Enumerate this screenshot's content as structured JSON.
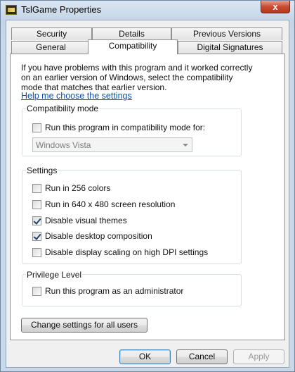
{
  "window": {
    "title": "TslGame Properties",
    "close_label": "x"
  },
  "tabs": {
    "row1": [
      "Security",
      "Details",
      "Previous Versions"
    ],
    "row2": [
      "General",
      "Compatibility",
      "Digital Signatures"
    ]
  },
  "intro": {
    "text": "If you have problems with this program and it worked correctly on an earlier version of Windows, select the compatibility mode that matches that earlier version.",
    "help_link": "Help me choose the settings"
  },
  "compat_mode": {
    "label": "Compatibility mode",
    "checkbox_label": "Run this program in compatibility mode for:",
    "checked": false,
    "selected_os": "Windows Vista"
  },
  "settings": {
    "label": "Settings",
    "items": [
      {
        "label": "Run in 256 colors",
        "checked": false
      },
      {
        "label": "Run in 640 x 480 screen resolution",
        "checked": false
      },
      {
        "label": "Disable visual themes",
        "checked": true
      },
      {
        "label": "Disable desktop composition",
        "checked": true
      },
      {
        "label": "Disable display scaling on high DPI settings",
        "checked": false
      }
    ]
  },
  "privilege": {
    "label": "Privilege Level",
    "checkbox_label": "Run this program as an administrator",
    "checked": false
  },
  "buttons": {
    "all_users": "Change settings for all users",
    "ok": "OK",
    "cancel": "Cancel",
    "apply": "Apply"
  }
}
